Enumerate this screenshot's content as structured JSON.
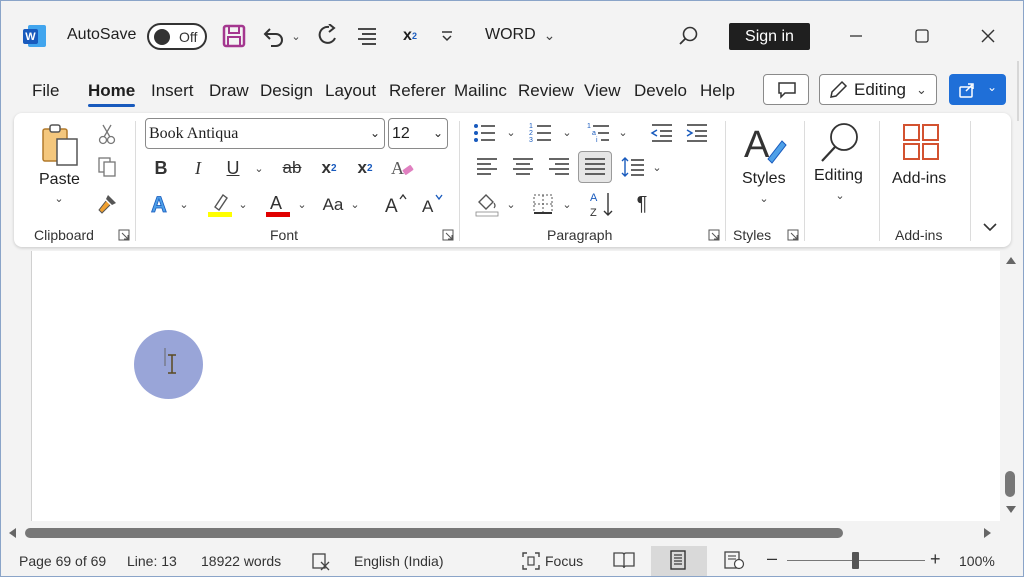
{
  "titlebar": {
    "app_icon": "word-logo-icon",
    "autosave_label": "AutoSave",
    "autosave_state": "Off",
    "doc_title": "WORD",
    "signin_label": "Sign in"
  },
  "tabs": [
    {
      "label": "File"
    },
    {
      "label": "Home"
    },
    {
      "label": "Insert"
    },
    {
      "label": "Draw"
    },
    {
      "label": "Design"
    },
    {
      "label": "Layout"
    },
    {
      "label": "Referer"
    },
    {
      "label": "Mailinc"
    },
    {
      "label": "Review"
    },
    {
      "label": "View"
    },
    {
      "label": "Develo"
    },
    {
      "label": "Help"
    }
  ],
  "active_tab": "Home",
  "header_buttons": {
    "editing_label": "Editing"
  },
  "ribbon": {
    "clipboard": {
      "paste_label": "Paste",
      "group_label": "Clipboard"
    },
    "font": {
      "font_name": "Book Antiqua",
      "font_size": "12",
      "group_label": "Font",
      "case_label": "Aa"
    },
    "paragraph": {
      "group_label": "Paragraph"
    },
    "styles": {
      "label": "Styles",
      "group_label": "Styles"
    },
    "editing": {
      "label": "Editing"
    },
    "addins": {
      "label": "Add-ins",
      "group_label": "Add-ins"
    }
  },
  "colors": {
    "accent": "#185abd",
    "share": "#1f6fd8",
    "highlight": "#ffff00",
    "font_color": "#e00000",
    "cursor_circle": "#8e9bd4"
  },
  "statusbar": {
    "page": "Page 69 of 69",
    "line": "Line: 13",
    "words": "18922 words",
    "language": "English (India)",
    "focus": "Focus",
    "zoom": "100%"
  }
}
